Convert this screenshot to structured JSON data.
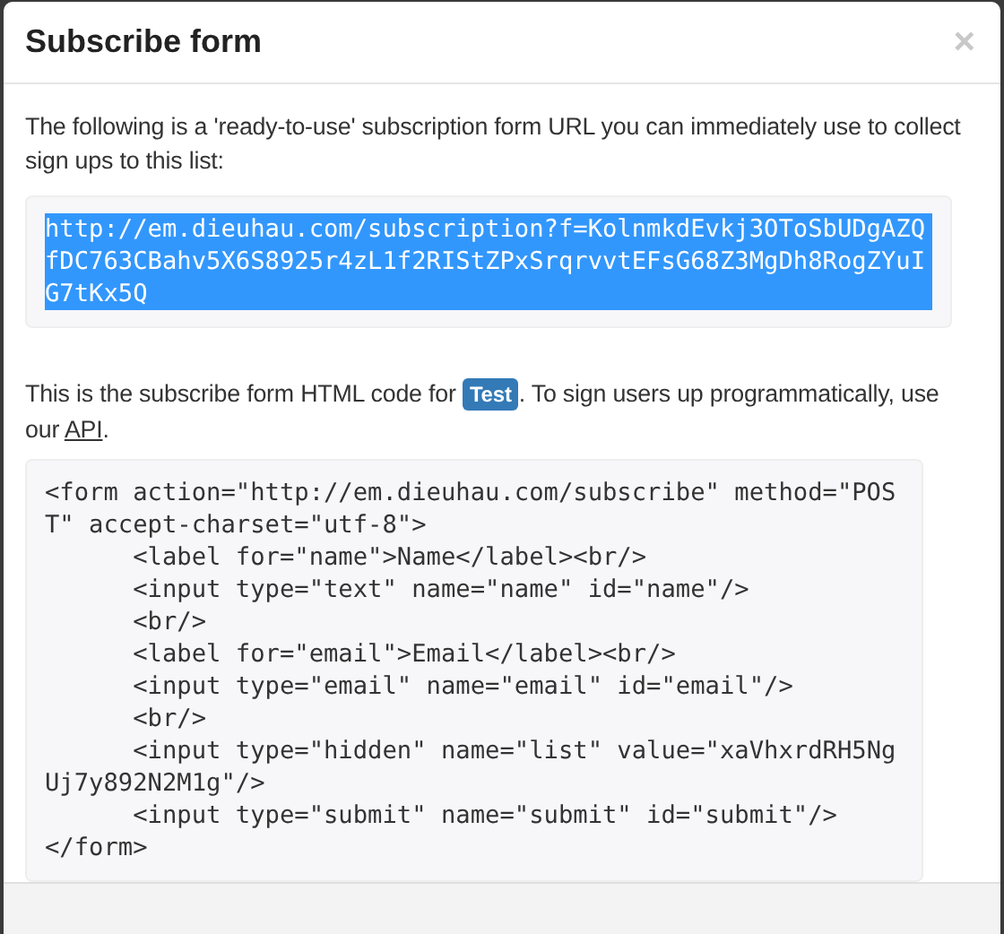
{
  "modal": {
    "title": "Subscribe form",
    "close": "×"
  },
  "intro": "The following is a 'ready-to-use' subscription form URL you can immediately use to collect sign ups to this list:",
  "url": {
    "text": "http://em.dieuhau.com/subscription?f=KolnmkdEvkj3OToSbUDgAZQfDC763CBahv5X6S8925r4zL1f2RIStZPxSrqrvvtEFsG68Z3MgDh8RogZYuIG7tKx5Q",
    "selected": true
  },
  "html_note": {
    "before": "This is the subscribe form HTML code for ",
    "badge": "Test",
    "middle": ". To sign users up programmatically, use our ",
    "link": "API",
    "after": "."
  },
  "code": [
    "<form action=\"http://em.dieuhau.com/subscribe\" method=\"POST\" accept-charset=\"utf-8\">",
    "\t<label for=\"name\">Name</label><br/>",
    "\t<input type=\"text\" name=\"name\" id=\"name\"/>",
    "\t<br/>",
    "\t<label for=\"email\">Email</label><br/>",
    "\t<input type=\"email\" name=\"email\" id=\"email\"/>",
    "\t<br/>",
    "\t<input type=\"hidden\" name=\"list\" value=\"xaVhxrdRH5NgUj7y892N2M1g\"/>",
    "\t<input type=\"submit\" name=\"submit\" id=\"submit\"/>",
    "</form>"
  ]
}
